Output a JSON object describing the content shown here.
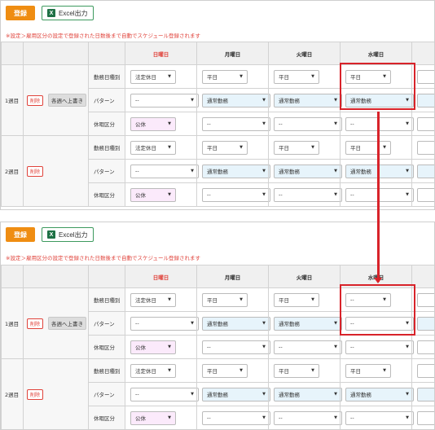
{
  "toolbar": {
    "register_label": "登録",
    "excel_label": "Excel出力",
    "excel_icon": "X"
  },
  "note": "※設定＞雇用区分の設定で登録された日数後まで自動でスケジュール登録されます",
  "headers": [
    "日曜日",
    "月曜日",
    "火曜日",
    "水曜日"
  ],
  "row_labels": {
    "day_type": "勤務日種別",
    "pattern": "パターン",
    "holiday": "休暇区分"
  },
  "buttons": {
    "delete": "削除",
    "overwrite": "各週へ上書き"
  },
  "weeks": [
    {
      "label": "1週目"
    },
    {
      "label": "2週目"
    }
  ],
  "top": {
    "week1": {
      "day_type": [
        "法定休日",
        "平日",
        "平日",
        "平日"
      ],
      "pattern": [
        "--",
        "通常勤務",
        "通常勤務",
        "通常勤務"
      ],
      "holiday": [
        "公休",
        "--",
        "--",
        "--"
      ]
    },
    "week2": {
      "day_type": [
        "法定休日",
        "平日",
        "平日",
        "平日"
      ],
      "pattern": [
        "--",
        "通常勤務",
        "通常勤務",
        "通常勤務"
      ],
      "holiday": [
        "公休",
        "--",
        "--",
        "--"
      ]
    }
  },
  "bottom": {
    "week1": {
      "day_type": [
        "法定休日",
        "平日",
        "平日",
        "--"
      ],
      "pattern": [
        "--",
        "通常勤務",
        "通常勤務",
        "--"
      ],
      "holiday": [
        "公休",
        "--",
        "--",
        "--"
      ]
    },
    "week2": {
      "day_type": [
        "法定休日",
        "平日",
        "平日",
        "平日"
      ],
      "pattern": [
        "--",
        "通常勤務",
        "通常勤務",
        "通常勤務"
      ],
      "holiday": [
        "公休",
        "--",
        "--",
        "--"
      ]
    }
  },
  "colors": {
    "accent": "#ef8d12",
    "highlight": "#d8232a",
    "sunday": "#e0433b",
    "pattern_bg": "#e7f4fb",
    "holiday_bg": "#fbeafb"
  }
}
